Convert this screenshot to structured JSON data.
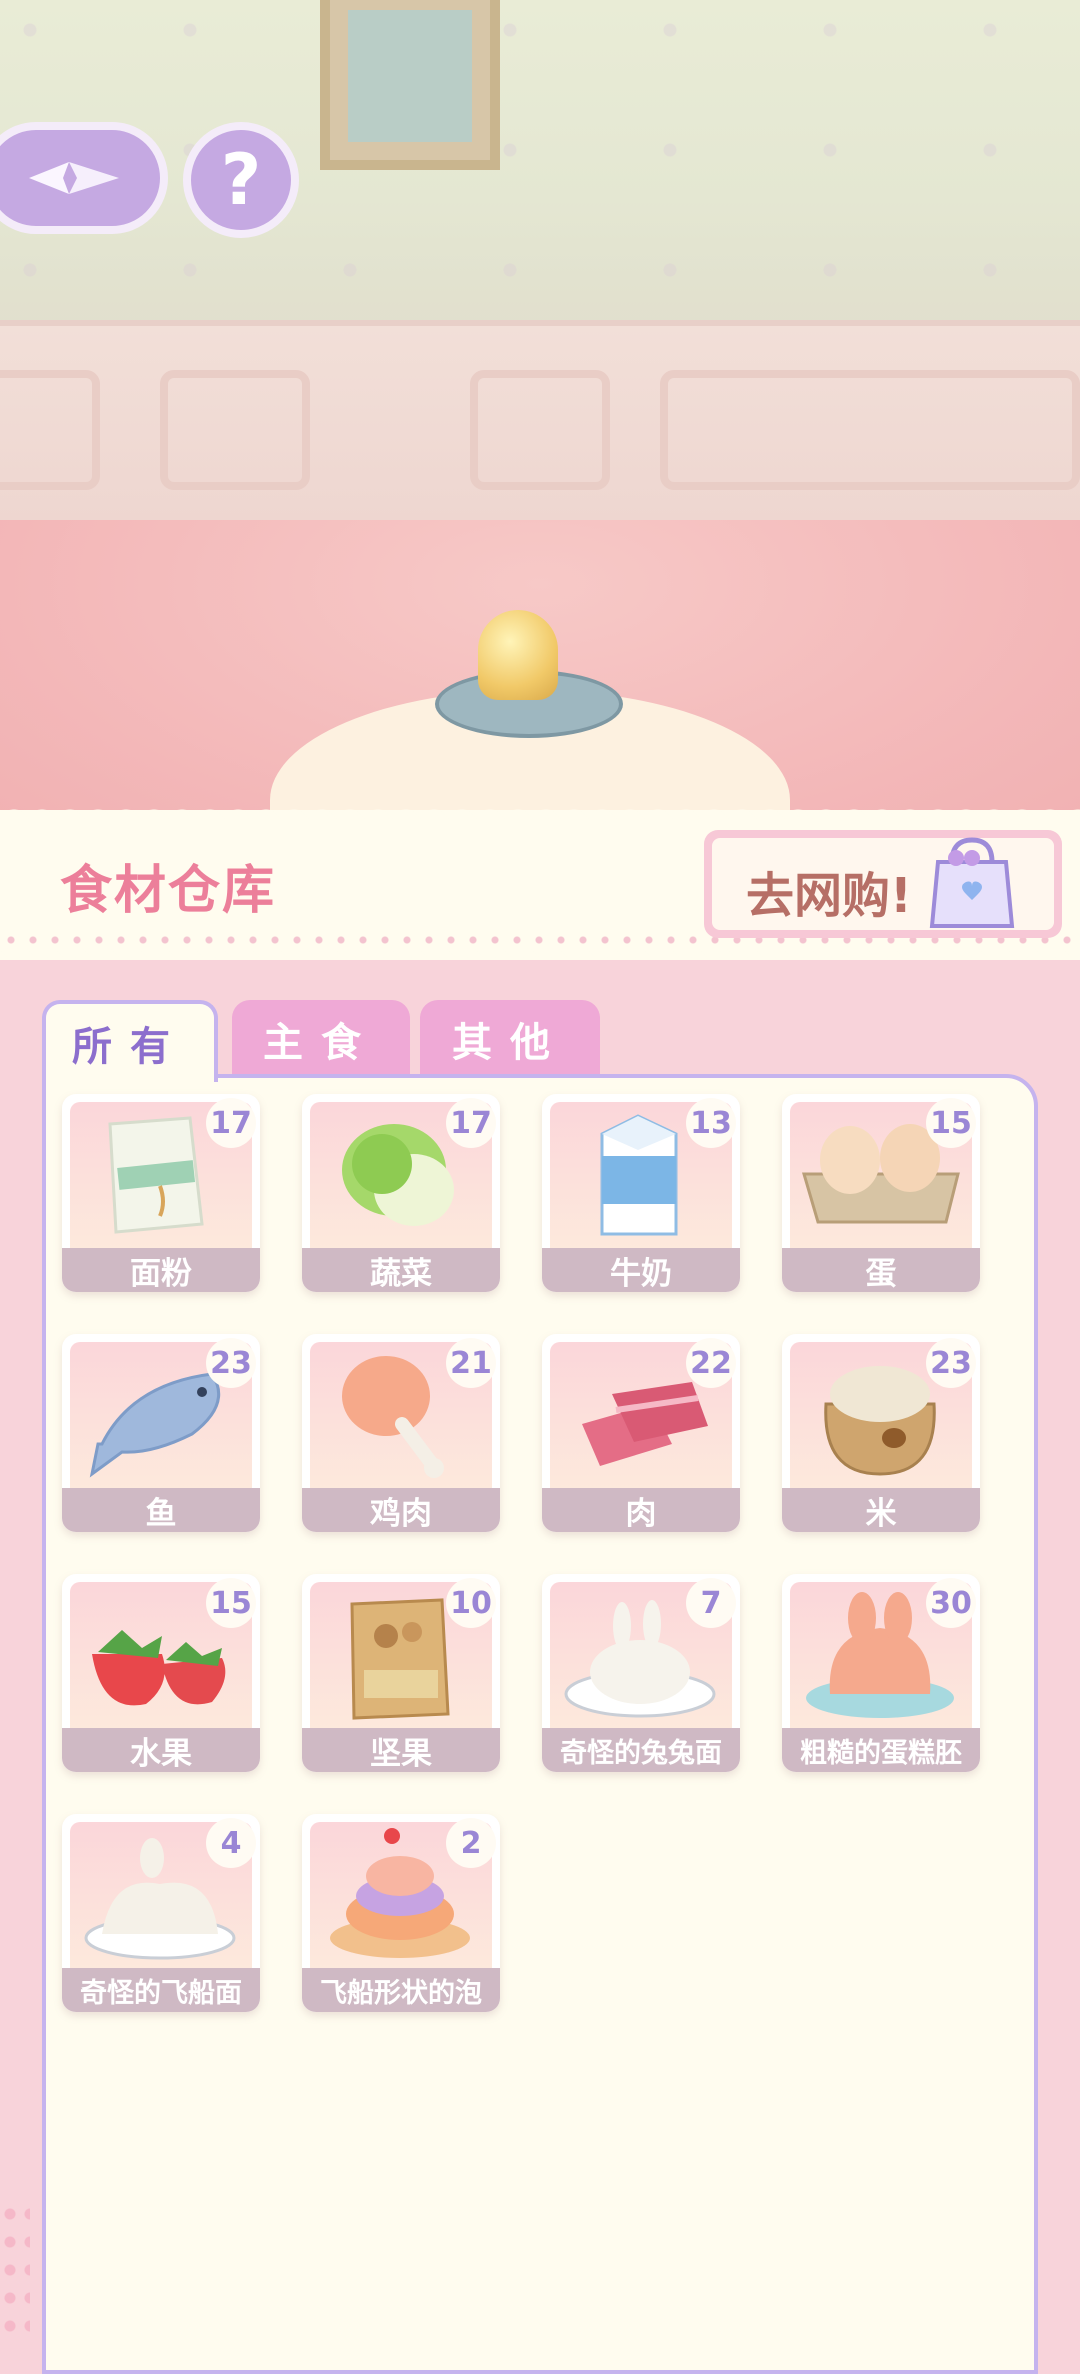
{
  "header": {
    "title": "食材仓库",
    "shop_label": "去网购!"
  },
  "nav": {
    "help_glyph": "?"
  },
  "tabs": [
    {
      "label": "所有",
      "active": true
    },
    {
      "label": "主食",
      "active": false
    },
    {
      "label": "其他",
      "active": false
    }
  ],
  "items": [
    {
      "name": "面粉",
      "count": "17",
      "icon": "flour-bag-icon"
    },
    {
      "name": "蔬菜",
      "count": "17",
      "icon": "cabbage-icon"
    },
    {
      "name": "牛奶",
      "count": "13",
      "icon": "milk-carton-icon"
    },
    {
      "name": "蛋",
      "count": "15",
      "icon": "eggs-icon"
    },
    {
      "name": "鱼",
      "count": "23",
      "icon": "fish-icon"
    },
    {
      "name": "鸡肉",
      "count": "21",
      "icon": "chicken-leg-icon"
    },
    {
      "name": "肉",
      "count": "22",
      "icon": "meat-icon"
    },
    {
      "name": "米",
      "count": "23",
      "icon": "rice-sack-icon"
    },
    {
      "name": "水果",
      "count": "15",
      "icon": "strawberry-icon"
    },
    {
      "name": "坚果",
      "count": "10",
      "icon": "nuts-bag-icon"
    },
    {
      "name": "奇怪的兔兔面",
      "count": "7",
      "icon": "bunny-noodle-icon"
    },
    {
      "name": "粗糙的蛋糕胚",
      "count": "30",
      "icon": "bunny-cake-icon"
    },
    {
      "name": "奇怪的飞船面",
      "count": "4",
      "icon": "ship-noodle-icon"
    },
    {
      "name": "飞船形状的泡",
      "count": "2",
      "icon": "puff-pastry-icon"
    }
  ],
  "colors": {
    "accent_purple": "#c5a9e2",
    "title_pink": "#ec7f9a",
    "tab_pink": "#efa9d6",
    "label_bg": "#cfb9c4"
  }
}
